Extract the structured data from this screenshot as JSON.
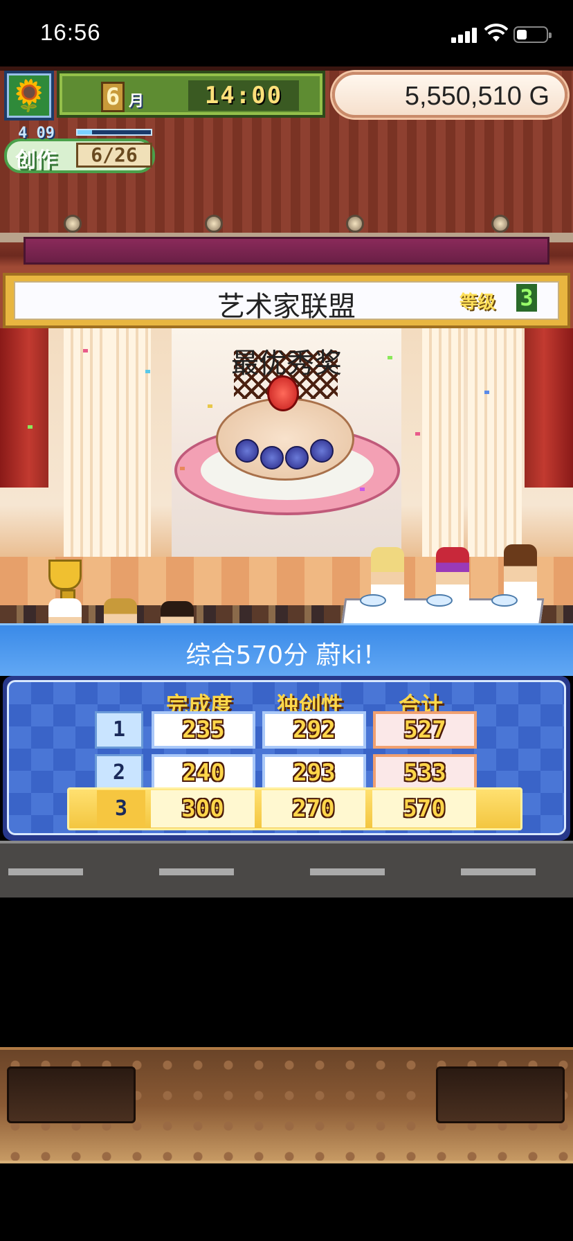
{
  "status_bar": {
    "time": "16:56"
  },
  "hud": {
    "month": "6",
    "month_unit": "月",
    "time": "14:00",
    "money": "5,550,510 G",
    "work_level": "4 09",
    "work_label": "创作",
    "work_count": "6/26"
  },
  "contest": {
    "title": "艺术家联盟",
    "grade_label": "等级",
    "grade": "3",
    "award": "最优秀奖"
  },
  "result": {
    "summary": "综合570分 蔚ki！",
    "headers": [
      "完成度",
      "独创性",
      "合计"
    ],
    "rows": [
      {
        "rank": "1",
        "completion": "235",
        "originality": "292",
        "total": "527"
      },
      {
        "rank": "2",
        "completion": "240",
        "originality": "293",
        "total": "533"
      },
      {
        "rank": "3",
        "completion": "300",
        "originality": "270",
        "total": "570"
      }
    ]
  },
  "colors": {
    "accent": "#3a8ae8",
    "score_text": "#ffd64a",
    "header_text": "#ffd84a"
  }
}
